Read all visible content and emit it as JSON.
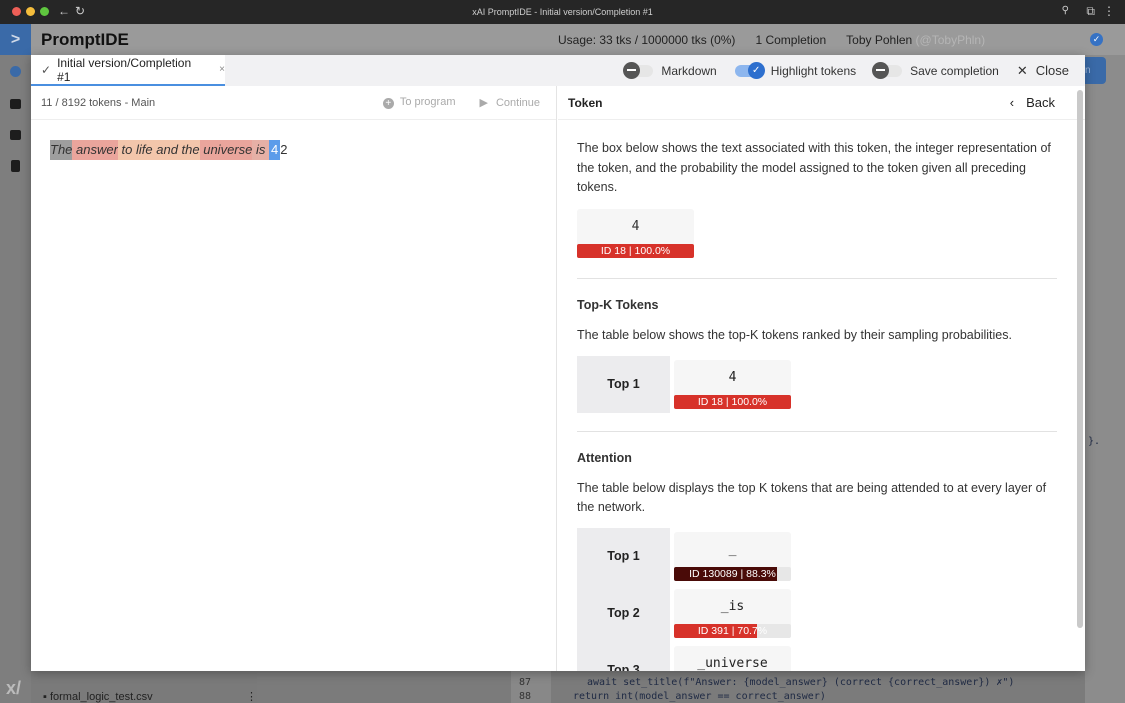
{
  "browser": {
    "title": "xAI PromptIDE - Initial version/Completion #1"
  },
  "header": {
    "brand": "PromptIDE",
    "usage": "Usage: 33 tks / 1000000 tks (0%)",
    "completions": "1 Completion",
    "user": "Toby Pohlen",
    "handle": "(@TobyPhln)"
  },
  "modal": {
    "tab": {
      "label": "Initial version/Completion #1"
    },
    "toggles": [
      {
        "label": "Markdown",
        "on": false
      },
      {
        "label": "Highlight tokens",
        "on": true
      },
      {
        "label": "Save completion",
        "on": false
      }
    ],
    "close_label": "Close",
    "left": {
      "status": "11 / 8192 tokens - Main",
      "to_program": "To program",
      "continue": "Continue",
      "tokens": [
        {
          "text": "The",
          "color": "#9e9e9e"
        },
        {
          "text": " answer",
          "color": "#eaa59c"
        },
        {
          "text": " to life and the",
          "color": "#f3c6ab"
        },
        {
          "text": " universe",
          "color": "#eaa59c"
        },
        {
          "text": " is ",
          "color": "#e6b0a6"
        },
        {
          "text": "4",
          "color": "#5b9cea"
        },
        {
          "text": "2",
          "color": ""
        }
      ]
    },
    "right": {
      "title": "Token",
      "back": "Back",
      "intro": "The box below shows the text associated with this token, the integer representation of the token, and the probability the model assigned to the token given all preceding tokens.",
      "token": {
        "text": "4",
        "label": "ID 18 | 100.0%",
        "prob": 100,
        "color": "#d7322a"
      },
      "topk": {
        "title": "Top-K Tokens",
        "desc": "The table below shows the top-K tokens ranked by their sampling probabilities.",
        "rows": [
          {
            "rank": "Top 1",
            "text": "4",
            "label": "ID 18 | 100.0%",
            "prob": 100,
            "color": "#d7322a"
          }
        ]
      },
      "attention": {
        "title": "Attention",
        "desc": "The table below displays the top K tokens that are being attended to at every layer of the network.",
        "rows": [
          {
            "rank": "Top 1",
            "text": "_",
            "label": "ID 130089 | 88.3%",
            "prob": 88.3,
            "color": "#4a0b08"
          },
          {
            "rank": "Top 2",
            "text": "_is",
            "label": "ID 391 | 70.7%",
            "prob": 70.7,
            "color": "#d7322a"
          },
          {
            "rank": "Top 3",
            "text": "_universe",
            "label": "",
            "prob": 0,
            "color": "#d7322a"
          }
        ]
      }
    }
  },
  "background": {
    "file": "formal_logic_test.csv",
    "lines": [
      "87",
      "88"
    ],
    "code": [
      "await set_title(f\"Answer: {model_answer} (correct {correct_answer}) ✗\")",
      "return int(model_answer == correct_answer)"
    ]
  }
}
